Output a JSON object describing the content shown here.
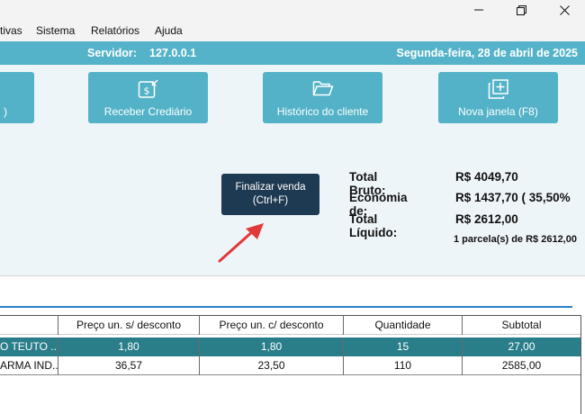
{
  "menu": {
    "items": [
      "tivas",
      "Sistema",
      "Relatórios",
      "Ajuda"
    ]
  },
  "window_controls": {
    "minimize_icon": "minimize-icon",
    "maximize_icon": "restore-icon",
    "close_icon": "close-icon"
  },
  "server_bar": {
    "label": "Servidor:",
    "ip": "127.0.0.1",
    "date": "Segunda-feira, 28 de abril de 2025"
  },
  "actions": {
    "left_partial_label": ")",
    "receber_label": "Receber Crediário",
    "historico_label": "Histórico do cliente",
    "nova_janela_label": "Nova janela (F8)"
  },
  "finalizar": {
    "line1": "Finalizar venda",
    "line2": "(Ctrl+F)"
  },
  "totals": {
    "bruto_label": "Total Bruto:",
    "bruto_value": "R$ 4049,70",
    "economia_label": "Economia de:",
    "economia_value": "R$ 1437,70 ( 35,50%",
    "liquido_label": "Total Líquido:",
    "liquido_value": "R$ 2612,00",
    "parcela": "1 parcela(s) de R$ 2612,00"
  },
  "table": {
    "headers": [
      "",
      "Preço un. s/ desconto",
      "Preço un. c/ desconto",
      "Quantidade",
      "Subtotal"
    ],
    "rows": [
      [
        "O TEUTO ...",
        "1,80",
        "1,80",
        "15",
        "27,00"
      ],
      [
        "ARMA IND...",
        "36,57",
        "23,50",
        "110",
        "2585,00"
      ]
    ]
  },
  "colors": {
    "accent": "#54b3c8",
    "dark_button": "#1e3a52",
    "selected_row": "#2a7e8a",
    "arrow": "#e03a3a"
  }
}
